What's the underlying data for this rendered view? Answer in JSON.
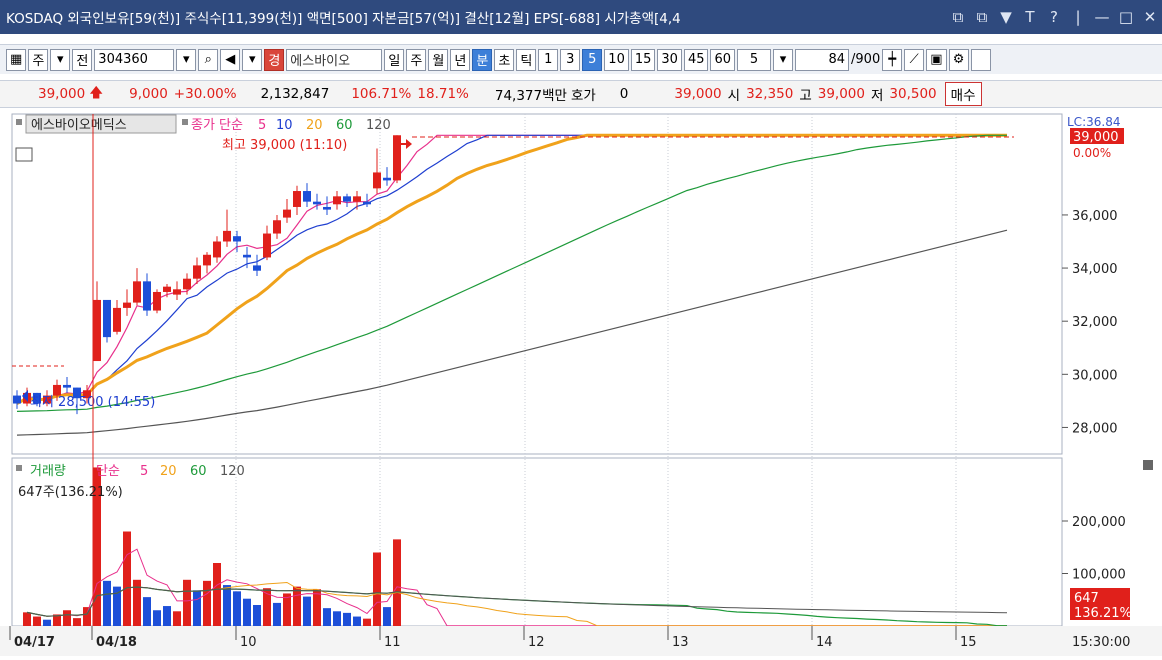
{
  "window": {
    "title": "KOSDAQ 외국인보유[59(천)] 주식수[11,399(천)] 액면[500] 자본금[57(억)] 결산[12월] EPS[-688] 시가총액[4,4",
    "buttons": [
      "⧉",
      "⧉",
      "▼",
      "T",
      "?",
      "|",
      "—",
      "□",
      "✕"
    ]
  },
  "toolbar": {
    "menu_icon": "▦",
    "type_label": "주",
    "prev_label": "전",
    "code_value": "304360",
    "stock_name": "에스바이오",
    "gyeong_label": "경",
    "periods": [
      "일",
      "주",
      "월",
      "년",
      "분",
      "초",
      "틱"
    ],
    "selected_period": "분",
    "intervals": [
      "1",
      "3",
      "5",
      "10",
      "15",
      "30",
      "45",
      "60"
    ],
    "selected_interval": "5",
    "interval_value": "5",
    "count_value": "84",
    "count_total": "/900"
  },
  "infobar": {
    "price": "39,000",
    "change": "9,000",
    "change_pct": "+30.00%",
    "volume": "2,132,847",
    "vol_ratio": "106.71%",
    "turnover": "18.71%",
    "amount": "74,377백만",
    "hoga_label": "호가",
    "hoga_value": "0",
    "hoga_price": "39,000",
    "open_label": "시",
    "open": "32,350",
    "high_label": "고",
    "high": "39,000",
    "low_label": "저",
    "low": "30,500",
    "buy_label": "매수"
  },
  "price_panel": {
    "legend_name": "에스바이오메딕스",
    "legend_ma": "종가 단순",
    "ma_periods": [
      "5",
      "10",
      "20",
      "60",
      "120"
    ],
    "high_annotation": "최고 39,000 (11:10)",
    "low_annotation": "최저 28,500 (14:55)",
    "current_price_badge": "39,000",
    "current_pct_badge": "0.00%",
    "top_right_label": "LC:36.84",
    "y_ticks": [
      "28,000",
      "30,000",
      "32,000",
      "34,000",
      "36,000"
    ]
  },
  "volume_panel": {
    "legend": "거래량",
    "legend_ma": "단순",
    "ma_periods": [
      "5",
      "20",
      "60",
      "120"
    ],
    "current_value": "647주(136.21%)",
    "badge_value": "647",
    "badge_pct": "136.21%",
    "y_ticks": [
      "100,000",
      "200,000"
    ]
  },
  "x_axis": {
    "labels": [
      "04/17",
      "04/18",
      "10",
      "11",
      "12",
      "13",
      "14",
      "15"
    ],
    "time_label": "15:30:00"
  },
  "colors": {
    "up": "#e0201b",
    "down": "#1d4fd8",
    "ma5": "#e8308c",
    "ma10": "#1f3fd0",
    "ma20": "#f0a21b",
    "ma60": "#1e9a3a",
    "ma120": "#555555"
  },
  "chart_data": {
    "type": "candlestick",
    "ylim": [
      27000,
      39800
    ],
    "candles": [
      [
        29200,
        29400,
        28700,
        28900
      ],
      [
        28900,
        29500,
        28800,
        29300
      ],
      [
        29300,
        29300,
        28800,
        28900
      ],
      [
        28900,
        29400,
        28800,
        29200
      ],
      [
        29200,
        29800,
        29000,
        29600
      ],
      [
        29600,
        29900,
        29300,
        29500
      ],
      [
        29500,
        29500,
        28500,
        29100
      ],
      [
        29100,
        29600,
        28900,
        29400
      ],
      [
        30500,
        33500,
        30500,
        32800
      ],
      [
        32800,
        32800,
        31200,
        31400
      ],
      [
        31600,
        32800,
        31500,
        32500
      ],
      [
        32500,
        33200,
        32200,
        32700
      ],
      [
        32700,
        34000,
        32600,
        33500
      ],
      [
        33500,
        33800,
        32200,
        32400
      ],
      [
        32400,
        33200,
        32300,
        33100
      ],
      [
        33100,
        33400,
        32900,
        33300
      ],
      [
        33000,
        33500,
        32800,
        33200
      ],
      [
        33200,
        33800,
        33000,
        33600
      ],
      [
        33600,
        34400,
        33400,
        34100
      ],
      [
        34100,
        34600,
        33800,
        34500
      ],
      [
        34400,
        35200,
        34200,
        35000
      ],
      [
        35000,
        36200,
        34800,
        35400
      ],
      [
        35200,
        35400,
        34600,
        35000
      ],
      [
        34500,
        34800,
        34000,
        34400
      ],
      [
        34100,
        34500,
        33700,
        33900
      ],
      [
        34400,
        35600,
        34300,
        35300
      ],
      [
        35300,
        36000,
        35100,
        35800
      ],
      [
        35900,
        36600,
        35700,
        36200
      ],
      [
        36300,
        37100,
        36000,
        36900
      ],
      [
        36900,
        37200,
        36300,
        36500
      ],
      [
        36500,
        36800,
        36200,
        36400
      ],
      [
        36300,
        36700,
        36000,
        36200
      ],
      [
        36400,
        36900,
        36200,
        36700
      ],
      [
        36700,
        36800,
        36300,
        36500
      ],
      [
        36500,
        36900,
        36200,
        36700
      ],
      [
        36500,
        36800,
        36300,
        36400
      ],
      [
        37000,
        38500,
        36800,
        37600
      ],
      [
        37400,
        37800,
        37100,
        37300
      ],
      [
        37300,
        39000,
        37200,
        39000
      ]
    ],
    "volume": [
      [
        26000,
        1
      ],
      [
        18000,
        1
      ],
      [
        12000,
        -1
      ],
      [
        22000,
        1
      ],
      [
        30000,
        1
      ],
      [
        15000,
        1
      ],
      [
        36000,
        1
      ],
      [
        302000,
        1
      ],
      [
        86000,
        -1
      ],
      [
        75000,
        -1
      ],
      [
        180000,
        1
      ],
      [
        88000,
        1
      ],
      [
        55000,
        -1
      ],
      [
        30000,
        -1
      ],
      [
        38000,
        -1
      ],
      [
        28000,
        1
      ],
      [
        88000,
        1
      ],
      [
        68000,
        -1
      ],
      [
        86000,
        1
      ],
      [
        120000,
        1
      ],
      [
        78000,
        -1
      ],
      [
        66000,
        -1
      ],
      [
        52000,
        -1
      ],
      [
        40000,
        -1
      ],
      [
        72000,
        1
      ],
      [
        44000,
        -1
      ],
      [
        62000,
        1
      ],
      [
        75000,
        1
      ],
      [
        56000,
        -1
      ],
      [
        70000,
        1
      ],
      [
        34000,
        -1
      ],
      [
        28000,
        -1
      ],
      [
        25000,
        -1
      ],
      [
        18000,
        -1
      ],
      [
        14000,
        1
      ],
      [
        140000,
        1
      ],
      [
        36000,
        -1
      ],
      [
        165000,
        1
      ]
    ],
    "x_labels": [
      "04/17",
      "04/18",
      "10",
      "11",
      "12",
      "13",
      "14",
      "15"
    ]
  }
}
